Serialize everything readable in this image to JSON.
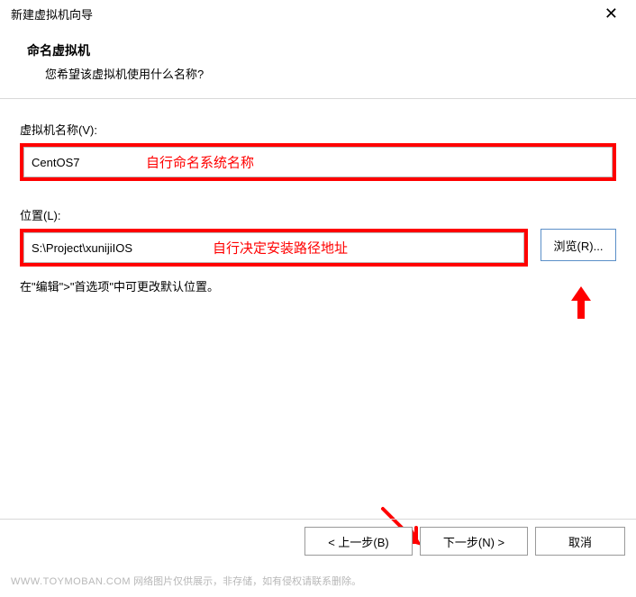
{
  "titlebar": {
    "title": "新建虚拟机向导"
  },
  "header": {
    "main": "命名虚拟机",
    "sub": "您希望该虚拟机使用什么名称?"
  },
  "form": {
    "name_label": "虚拟机名称(V):",
    "name_value": "CentOS7",
    "name_annotation": "自行命名系统名称",
    "location_label": "位置(L):",
    "location_value": "S:\\Project\\xunijiIOS",
    "location_annotation": "自行决定安装路径地址",
    "browse_label": "浏览(R)...",
    "hint": "在\"编辑\">\"首选项\"中可更改默认位置。"
  },
  "buttons": {
    "back": "< 上一步(B)",
    "next": "下一步(N) >",
    "cancel": "取消"
  },
  "watermark": {
    "site": "WWW.TOYMOBAN.COM",
    "text": "网络图片仅供展示，非存储，如有侵权请联系删除。"
  }
}
